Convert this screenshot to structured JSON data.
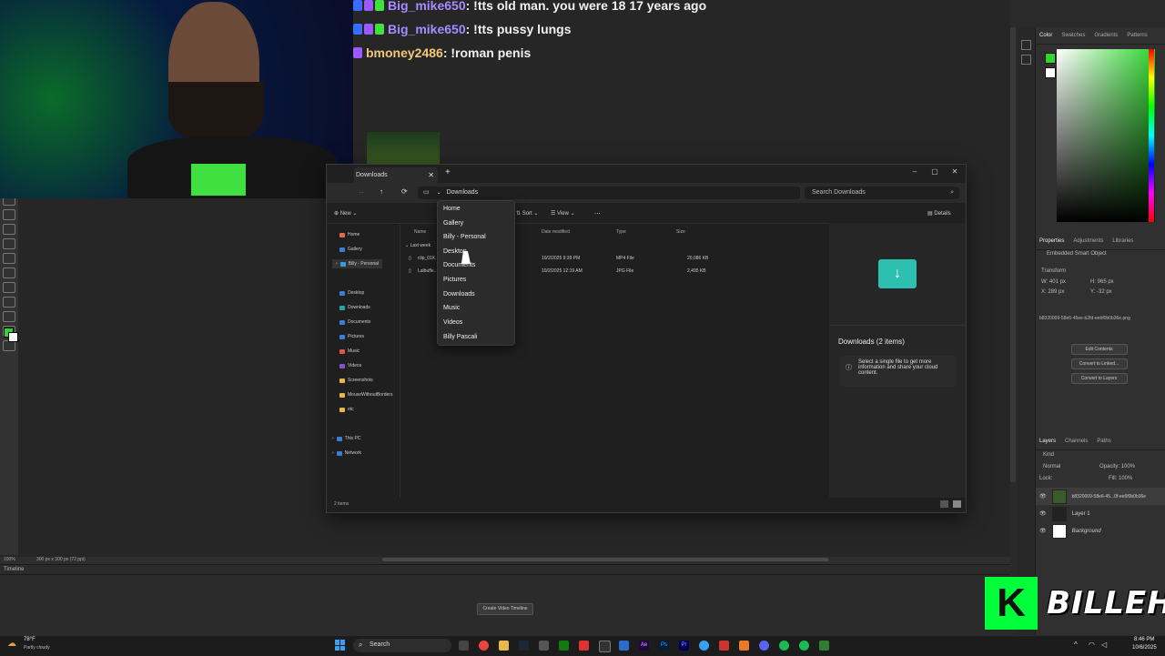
{
  "chat": {
    "messages": [
      {
        "user": "Big_mike650",
        "text": ": !tts old man. you were 18 17 years ago"
      },
      {
        "user": "Big_mike650",
        "text": ": !tts pussy lungs"
      },
      {
        "user": "bmoney2486",
        "text": ": !roman penis"
      }
    ]
  },
  "explorer": {
    "tab_title": "Downloads",
    "address_path": "Downloads",
    "search_placeholder": "Search Downloads",
    "commands": {
      "new": "New",
      "sort": "Sort",
      "view": "View",
      "more": "...",
      "details": "Details"
    },
    "sidebar": {
      "top": [
        "Home",
        "Gallery",
        "Billy - Personal"
      ],
      "pinned": [
        "Desktop",
        "Downloads",
        "Documents",
        "Pictures",
        "Music",
        "Videos",
        "Screenshots",
        "MouseWithoutBorders",
        "etc"
      ],
      "bottom": [
        "This PC",
        "Network"
      ]
    },
    "columns": {
      "name": "Name",
      "date": "Date modified",
      "type": "Type",
      "size": "Size"
    },
    "group_label": "Last week",
    "files": [
      {
        "name": "clip_01K...",
        "date": "10/2/2025 9:39 PM",
        "type": "MP4 File",
        "size": "20,086 KB"
      },
      {
        "name": "Lalbuffe...",
        "date": "10/2/2025 12:19 AM",
        "type": "JPG File",
        "size": "2,495 KB"
      }
    ],
    "dropdown": [
      "Home",
      "Gallery",
      "Billy - Personal",
      "Desktop",
      "Documents",
      "Pictures",
      "Downloads",
      "Music",
      "Videos",
      "Billy Pascali"
    ],
    "details_title": "Downloads (2 items)",
    "details_info": "Select a single file to get more information and share your cloud content.",
    "status": "2 items"
  },
  "photoshop": {
    "color_tabs": [
      "Color",
      "Swatches",
      "Gradients",
      "Patterns"
    ],
    "properties_tabs": [
      "Properties",
      "Adjustments",
      "Libraries"
    ],
    "properties_object": "Embedded Smart Object",
    "transform_label": "Transform",
    "transform_fields": {
      "w": "W: 401 px",
      "h": "H: 965 px",
      "x": "X: 289 px",
      "y": "Y: -32 px"
    },
    "filename": "b8320009-58e6-45ee-b2fd-eebf0b0b36e.png",
    "buttons": [
      "Edit Contents",
      "Convert to Linked...",
      "Convert to Layers"
    ],
    "layers_tabs": [
      "Layers",
      "Channels",
      "Paths"
    ],
    "layers_kind": "Kind",
    "blend_mode": "Normal",
    "opacity": "Opacity: 100%",
    "fill": "Fill: 100%",
    "lock_label": "Lock:",
    "layers": [
      "b8320009-58e6-45...0f-ee6f0b0b36e",
      "Layer 1",
      "Background"
    ],
    "status_zoom": "100%",
    "status_doc": "300 px x 300 px (72 ppi)",
    "timeline_label": "Timeline",
    "timeline_button": "Create Video Timeline"
  },
  "overlay": {
    "logo_letter": "K",
    "logo_text": "BILLEH"
  },
  "taskbar": {
    "weather_temp": "78°F",
    "weather_desc": "Partly cloudy",
    "search_label": "Search",
    "time": "8:46 PM",
    "date": "10/6/2025"
  },
  "colors": {
    "accent_green": "#2fd62f",
    "chat_purple": "#a58cff",
    "chat_gold": "#f1c878"
  }
}
